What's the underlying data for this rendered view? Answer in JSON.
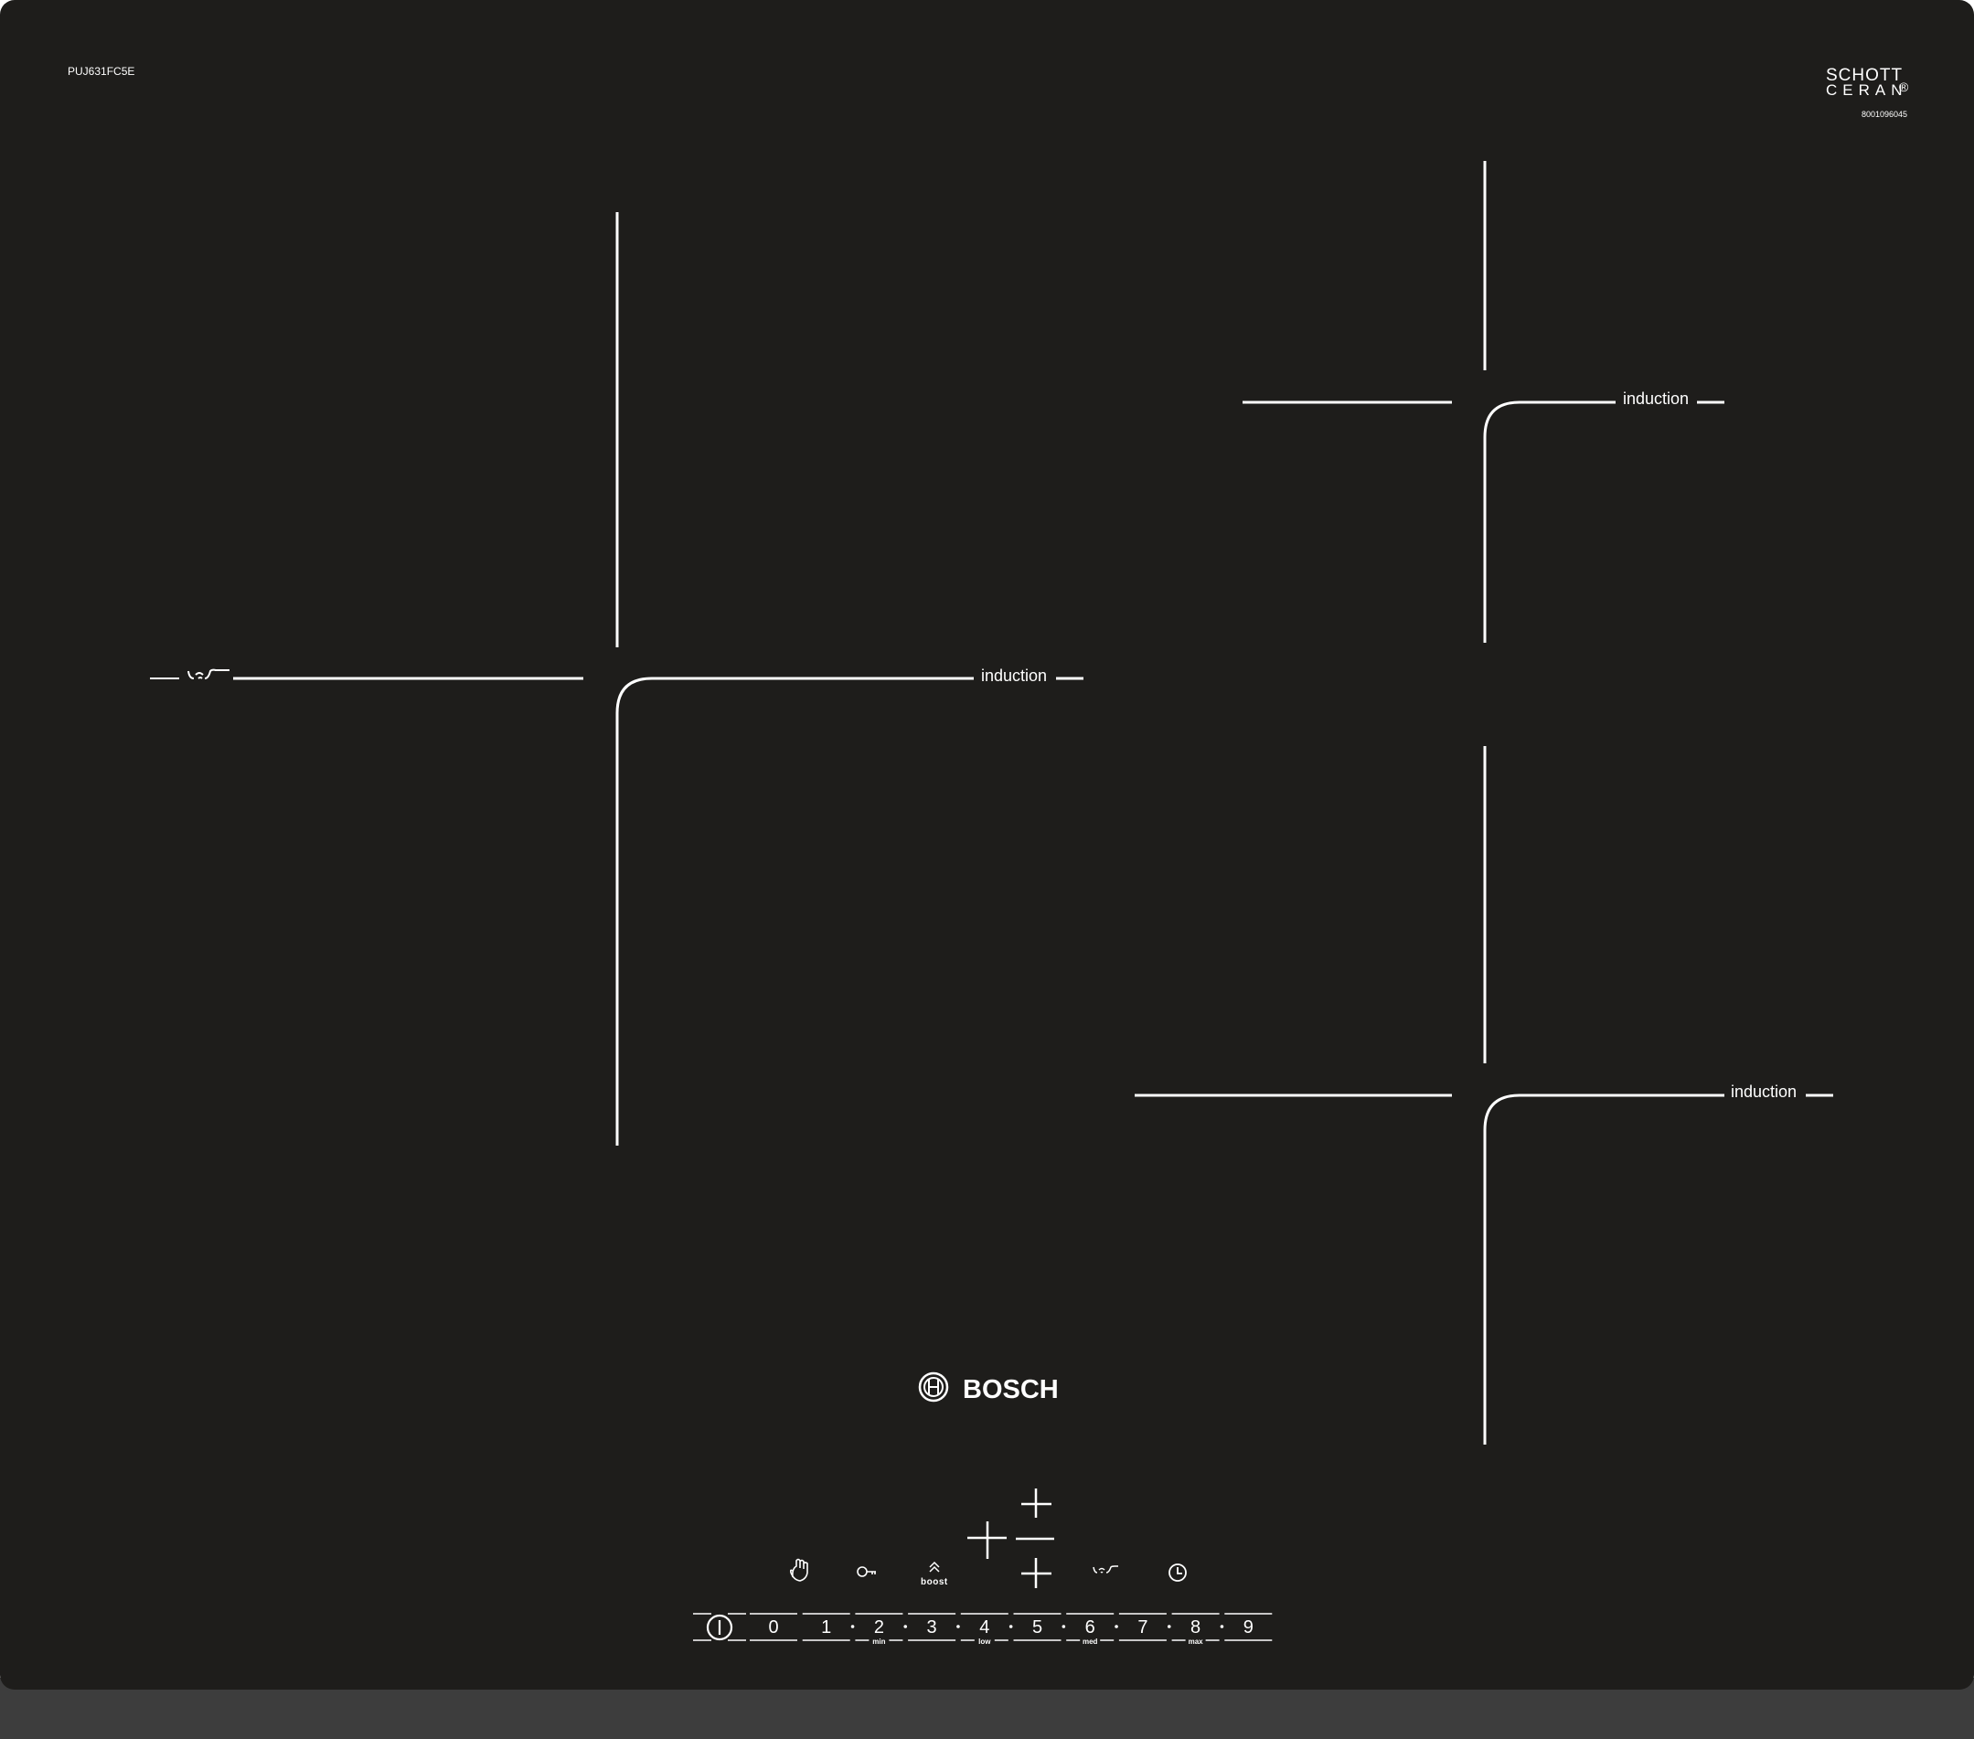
{
  "model": "PUJ631FC5E",
  "glass_brand": {
    "line1": "SCHOTT",
    "line2": "CERAN",
    "reg": "®",
    "code": "8001096045"
  },
  "zone_label": "induction",
  "brand": "BOSCH",
  "boost_label": "boost",
  "power_levels": [
    "0",
    "1",
    "2",
    "3",
    "4",
    "5",
    "6",
    "7",
    "8",
    "9"
  ],
  "level_sublabels": {
    "min": "min",
    "low": "low",
    "med": "med",
    "max": "max"
  },
  "colors": {
    "glass": "#1e1d1b",
    "frame": "#3d3d3d",
    "print": "#ffffff"
  },
  "icons": [
    "power-icon",
    "hand-icon",
    "key-icon",
    "boost-icon",
    "plus-icon",
    "flex-icon",
    "clock-icon"
  ]
}
